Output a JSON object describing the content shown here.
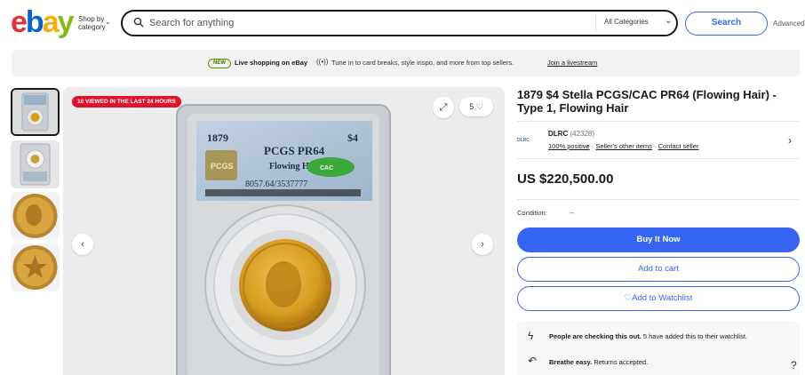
{
  "header": {
    "logo_letters": [
      "e",
      "b",
      "a",
      "y"
    ],
    "shop_by_line1": "Shop by",
    "shop_by_line2": "category",
    "search_placeholder": "Search for anything",
    "category_select": "All Categories",
    "search_button": "Search",
    "advanced_link": "Advanced"
  },
  "banner": {
    "badge": "NEW",
    "title": "Live shopping on eBay",
    "icon": "((•))",
    "description": "Tune in to card breaks, style inspo, and more from top sellers.",
    "link": "Join a livestream"
  },
  "gallery": {
    "thumbnails": [
      "slab-front-thumb",
      "slab-back-thumb",
      "coin-obverse-thumb",
      "coin-reverse-thumb"
    ],
    "viewed_badge": "10 VIEWED IN THE LAST 24 HOURS",
    "watch_count": "5",
    "slab": {
      "year": "1879",
      "denomination": "$4",
      "grade": "PCGS PR64",
      "variety": "Flowing Ha",
      "cert": "8057.64/3537777",
      "pcgs_logo": "PCGS",
      "cac_label": "CAC"
    }
  },
  "listing": {
    "title": "1879 $4 Stella PCGS/CAC PR64 (Flowing Hair) - Type 1, Flowing Hair",
    "seller_logo": "DLRC",
    "seller_name": "DLRC",
    "seller_feedback": "(42328)",
    "positive": "100% positive",
    "sep1": "·",
    "other_items": "Seller's other items",
    "sep2": "·",
    "contact": "Contact seller",
    "price": "US $220,500.00",
    "condition_label": "Condition:",
    "condition_value": "--",
    "buy_now": "Buy It Now",
    "add_to_cart": "Add to cart",
    "add_to_watchlist": "Add to Watchlist",
    "info1_bold": "People are checking this out.",
    "info1_rest": " 5 have added this to their watchlist.",
    "info2_bold": "Breathe easy.",
    "info2_rest": " Returns accepted."
  },
  "help": "?",
  "colors": {
    "accent": "#3665f3",
    "badge_red": "#e0112b",
    "logo_e": "#e53238",
    "logo_b": "#0064d2",
    "logo_a": "#f5af02",
    "logo_y": "#86b817"
  }
}
